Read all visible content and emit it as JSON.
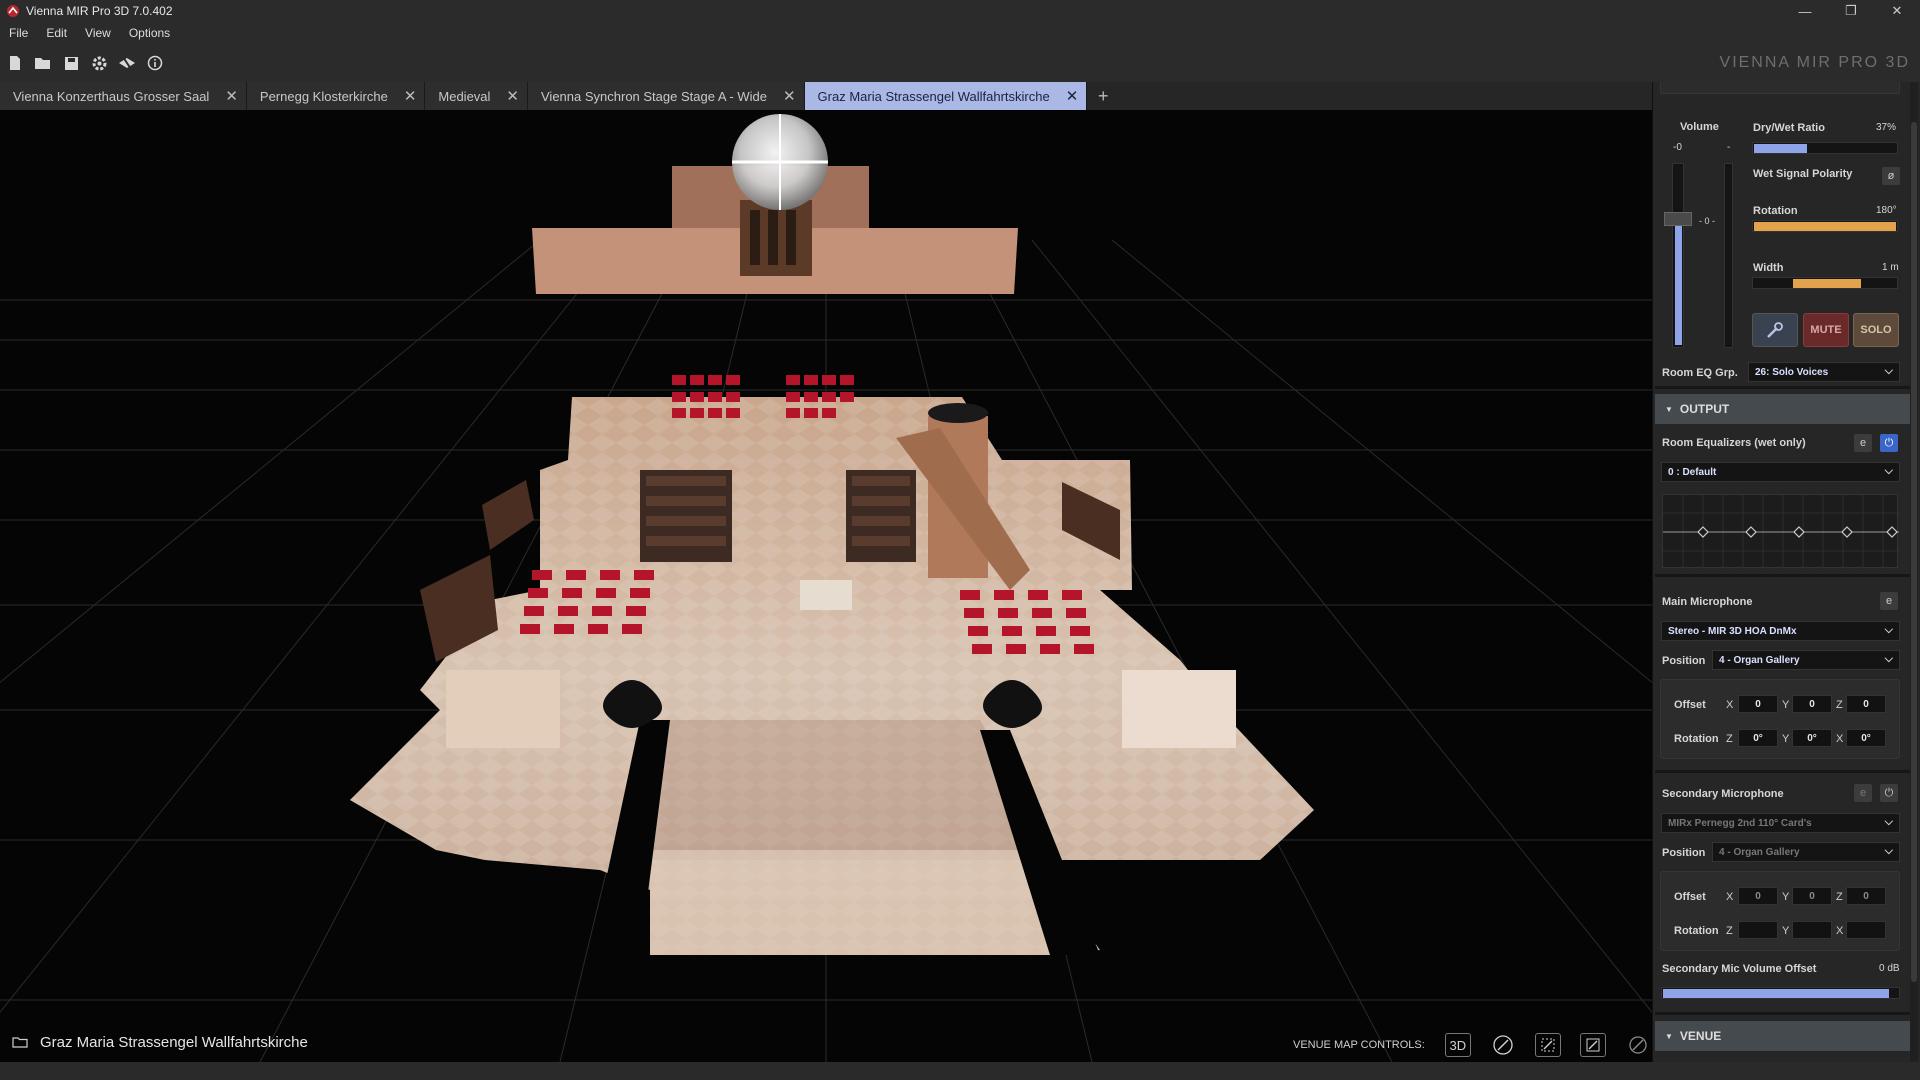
{
  "window": {
    "title": "Vienna MIR Pro 3D 7.0.402",
    "minimize_glyph": "—",
    "restore_glyph": "❐",
    "close_glyph": "✕"
  },
  "menu": [
    "File",
    "Edit",
    "View",
    "Options"
  ],
  "toolbar": {
    "brand": "VIENNA MIR PRO 3D",
    "icons": [
      "new-file-icon",
      "open-folder-icon",
      "save-icon",
      "settings-icon",
      "plugin-icon",
      "info-icon"
    ]
  },
  "tabs": [
    {
      "label": "Vienna Konzerthaus Grosser Saal",
      "active": false
    },
    {
      "label": "Pernegg Klosterkirche",
      "active": false
    },
    {
      "label": "Medieval",
      "active": false
    },
    {
      "label": "Vienna Synchron Stage Stage A - Wide",
      "active": false
    },
    {
      "label": "Graz Maria Strassengel Wallfahrtskirche",
      "active": true
    }
  ],
  "tab_add": "+",
  "venue_name": "Graz Maria Strassengel Wallfahrtskirche",
  "map_controls": {
    "label": "VENUE MAP CONTROLS:",
    "buttons": [
      "3D"
    ]
  },
  "panel": {
    "volume": {
      "label": "Volume",
      "top_left": "-0",
      "top_right": "-",
      "fader_readout": "- 0 -",
      "level_pct": 68
    },
    "dry_wet": {
      "label": "Dry/Wet Ratio",
      "value": "37%",
      "level_pct": 37
    },
    "wet_polarity": {
      "label": "Wet Signal Polarity",
      "button": "ø"
    },
    "rotation": {
      "label": "Rotation",
      "value": "180°",
      "level_pct": 100
    },
    "width": {
      "label": "Width",
      "value": "1 m"
    },
    "buttons": {
      "mute": "MUTE",
      "solo": "SOLO"
    },
    "room_eq_grp": {
      "label": "Room EQ Grp.",
      "value": "26: Solo Voices"
    },
    "output_header": "OUTPUT",
    "room_eq": {
      "label": "Room Equalizers (wet only)",
      "edit": "e",
      "preset": "0 : Default"
    },
    "main_mic": {
      "label": "Main Microphone",
      "edit": "e",
      "value": "Stereo - MIR 3D HOA DnMx",
      "position_label": "Position",
      "position": "4 - Organ Gallery",
      "offset_label": "Offset",
      "offset": {
        "x": "0",
        "y": "0",
        "z": "0"
      },
      "rotation_label": "Rotation",
      "rotation": {
        "z": "0°",
        "y": "0°",
        "x": "0°"
      }
    },
    "secondary_mic": {
      "label": "Secondary Microphone",
      "edit": "e",
      "value": "MIRx Pernegg 2nd 110° Card's",
      "position_label": "Position",
      "position": "4 - Organ Gallery",
      "offset_label": "Offset",
      "offset": {
        "x": "0",
        "y": "0",
        "z": "0"
      },
      "rotation_label": "Rotation",
      "rotation": {
        "z": "",
        "y": "",
        "x": ""
      }
    },
    "secondary_volume": {
      "label": "Secondary Mic Volume Offset",
      "value": "0 dB",
      "level_pct": 96
    },
    "venue_header": "VENUE",
    "axes": {
      "x": "X",
      "y": "Y",
      "z": "Z"
    },
    "colors": {
      "accent_blue": "#8fa3e8",
      "accent_orange": "#e3a24c",
      "mute_red": "#7a2e2e",
      "solo_brown": "#5e4a3a"
    }
  }
}
